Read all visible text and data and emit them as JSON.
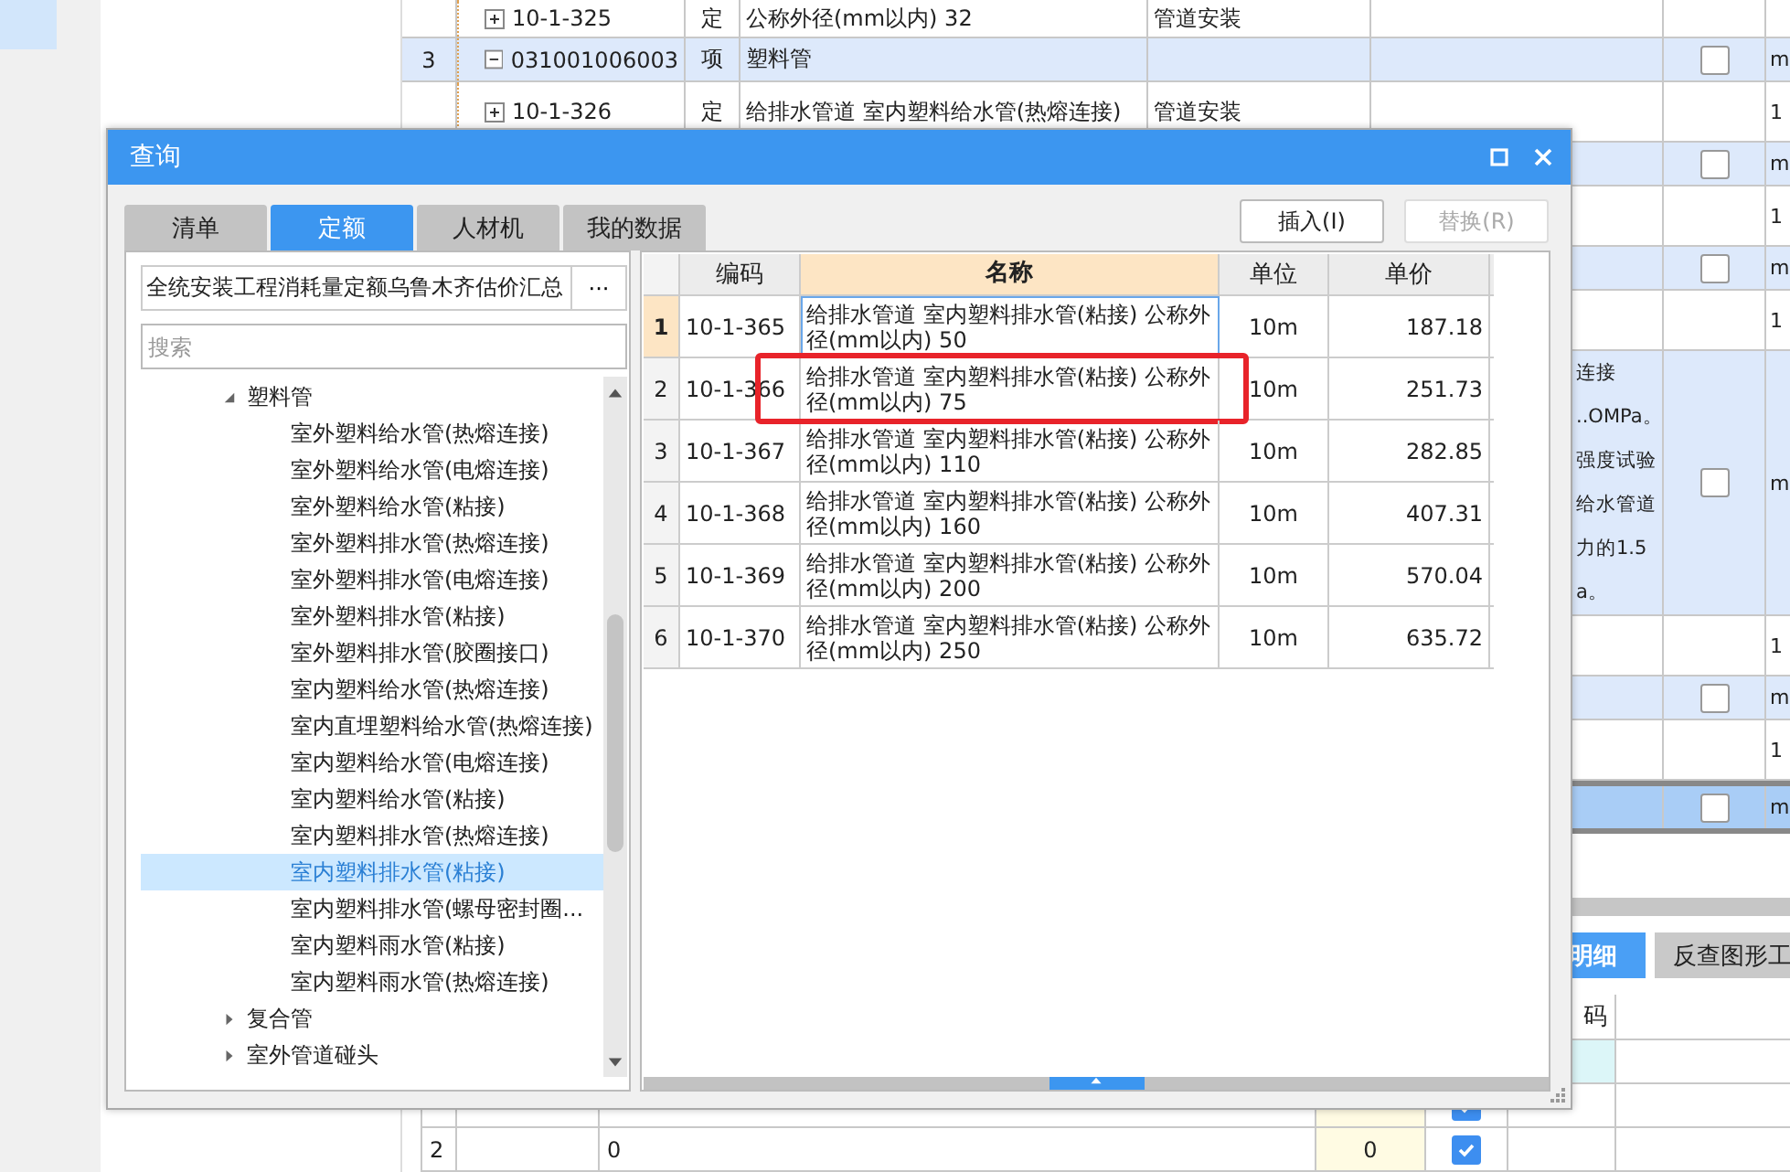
{
  "background": {
    "main_rows": [
      {
        "kind": "item",
        "selected": false,
        "code": "10-1-325",
        "type": "定",
        "name": "公称外径(mm以内) 32",
        "install": "管道安装"
      },
      {
        "kind": "group",
        "selected": false,
        "index": "3",
        "code": "031001006003",
        "type": "项",
        "name": "塑料管",
        "checked": false,
        "unit": "m"
      },
      {
        "kind": "item",
        "selected": false,
        "code": "10-1-326",
        "type": "定",
        "name": "给排水管道 室内塑料给水管(热熔连接)",
        "install": "管道安装",
        "unit": "1"
      },
      {
        "kind": "group",
        "selected": false,
        "checked": false,
        "unit": "m"
      },
      {
        "kind": "item",
        "selected": false,
        "unit": "1"
      },
      {
        "kind": "group",
        "selected": false,
        "checked": false,
        "unit": "m"
      },
      {
        "kind": "item",
        "selected": false,
        "unit": "1"
      },
      {
        "kind": "group",
        "selected": false,
        "note": [
          "连接",
          "..OMPa。",
          "强度试验",
          "给水管道",
          "力的1.5",
          "a。"
        ],
        "checked": false,
        "unit": "m"
      },
      {
        "kind": "item",
        "selected": false,
        "unit": "1"
      },
      {
        "kind": "group",
        "selected": false,
        "checked": false,
        "unit": "m"
      },
      {
        "kind": "item",
        "selected": false,
        "unit": "1"
      },
      {
        "kind": "group",
        "selected": true,
        "checked": false,
        "unit": "m"
      }
    ],
    "detail_tabs": [
      {
        "label": "明细",
        "selected": true
      },
      {
        "label": "反查图形工",
        "selected": false
      }
    ],
    "detail_table": {
      "column_6": "码",
      "rows": [
        {
          "index": "",
          "column_2": "",
          "value": "",
          "checked": true
        },
        {
          "index": "2",
          "column_2": "0",
          "value": "0",
          "checked": true
        }
      ]
    }
  },
  "dialog": {
    "title": "查询",
    "tabs": [
      {
        "label": "清单",
        "selected": false
      },
      {
        "label": "定额",
        "selected": true
      },
      {
        "label": "人材机",
        "selected": false
      },
      {
        "label": "我的数据",
        "selected": false
      }
    ],
    "buttons": [
      {
        "label": "插入(I)",
        "disabled": false
      },
      {
        "label": "替换(R)",
        "disabled": true
      }
    ],
    "library": {
      "value": "全统安装工程消耗量定额乌鲁木齐估价汇总",
      "button": "···"
    },
    "search": {
      "placeholder": "搜索"
    },
    "tree": [
      {
        "label": "塑料管",
        "expanded": true,
        "selected": false,
        "children": [
          {
            "label": "室外塑料给水管(热熔连接)",
            "selected": false
          },
          {
            "label": "室外塑料给水管(电熔连接)",
            "selected": false
          },
          {
            "label": "室外塑料给水管(粘接)",
            "selected": false
          },
          {
            "label": "室外塑料排水管(热熔连接)",
            "selected": false
          },
          {
            "label": "室外塑料排水管(电熔连接)",
            "selected": false
          },
          {
            "label": "室外塑料排水管(粘接)",
            "selected": false
          },
          {
            "label": "室外塑料排水管(胶圈接口)",
            "selected": false
          },
          {
            "label": "室内塑料给水管(热熔连接)",
            "selected": false
          },
          {
            "label": "室内直埋塑料给水管(热熔连接)",
            "selected": false
          },
          {
            "label": "室内塑料给水管(电熔连接)",
            "selected": false
          },
          {
            "label": "室内塑料给水管(粘接)",
            "selected": false
          },
          {
            "label": "室内塑料排水管(热熔连接)",
            "selected": false
          },
          {
            "label": "室内塑料排水管(粘接)",
            "selected": true
          },
          {
            "label": "室内塑料排水管(螺母密封圈...",
            "selected": false
          },
          {
            "label": "室内塑料雨水管(粘接)",
            "selected": false
          },
          {
            "label": "室内塑料雨水管(热熔连接)",
            "selected": false
          }
        ]
      },
      {
        "label": "复合管",
        "expanded": false,
        "selected": false
      },
      {
        "label": "室外管道碰头",
        "expanded": false,
        "selected": false
      }
    ],
    "table": {
      "columns": [
        {
          "label": "编码",
          "selected": false
        },
        {
          "label": "名称",
          "selected": true
        },
        {
          "label": "单位",
          "selected": false
        },
        {
          "label": "单价",
          "selected": false
        }
      ],
      "rows": [
        {
          "index": "1",
          "code": "10-1-365",
          "name": "给排水管道 室内塑料排水管(粘接) 公称外径(mm以内) 50",
          "unit": "10m",
          "price": "187.18",
          "selected": true,
          "highlighted": false
        },
        {
          "index": "2",
          "code": "10-1-366",
          "name": "给排水管道 室内塑料排水管(粘接) 公称外径(mm以内) 75",
          "unit": "10m",
          "price": "251.73",
          "selected": false,
          "highlighted": true
        },
        {
          "index": "3",
          "code": "10-1-367",
          "name": "给排水管道 室内塑料排水管(粘接) 公称外径(mm以内) 110",
          "unit": "10m",
          "price": "282.85",
          "selected": false,
          "highlighted": false
        },
        {
          "index": "4",
          "code": "10-1-368",
          "name": "给排水管道 室内塑料排水管(粘接) 公称外径(mm以内) 160",
          "unit": "10m",
          "price": "407.31",
          "selected": false,
          "highlighted": false
        },
        {
          "index": "5",
          "code": "10-1-369",
          "name": "给排水管道 室内塑料排水管(粘接) 公称外径(mm以内) 200",
          "unit": "10m",
          "price": "570.04",
          "selected": false,
          "highlighted": false
        },
        {
          "index": "6",
          "code": "10-1-370",
          "name": "给排水管道 室内塑料排水管(粘接) 公称外径(mm以内) 250",
          "unit": "10m",
          "price": "635.72",
          "selected": false,
          "highlighted": false
        }
      ]
    }
  }
}
